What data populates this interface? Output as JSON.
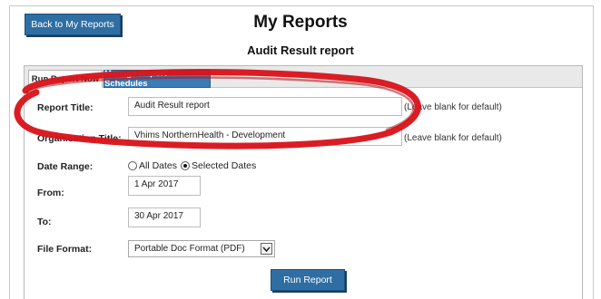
{
  "header": {
    "back_label": "Back to My Reports",
    "title": "My Reports",
    "subtitle": "Audit Result report"
  },
  "tabs": [
    {
      "label": "Run Report Now",
      "active": true
    },
    {
      "label": "Manage Report Schedules",
      "active": false
    }
  ],
  "form": {
    "report_title": {
      "label": "Report Title:",
      "value": "Audit Result report",
      "hint": "(Leave blank for default)"
    },
    "organisation_title": {
      "label": "Organisation Title:",
      "value": "Vhims NorthernHealth - Development",
      "hint": "(Leave blank for default)"
    },
    "date_range": {
      "label": "Date Range:",
      "options": [
        "All Dates",
        "Selected Dates"
      ],
      "selected": "Selected Dates"
    },
    "from": {
      "label": "From:",
      "value": "1 Apr 2017"
    },
    "to": {
      "label": "To:",
      "value": "30 Apr 2017"
    },
    "file_format": {
      "label": "File Format:",
      "value": "Portable Doc Format (PDF)"
    },
    "run_label": "Run Report"
  },
  "annotation": {
    "color": "#d8141b"
  },
  "colors": {
    "button": "#2f6ea3",
    "tab_active_bg": "#3a7cb3"
  }
}
